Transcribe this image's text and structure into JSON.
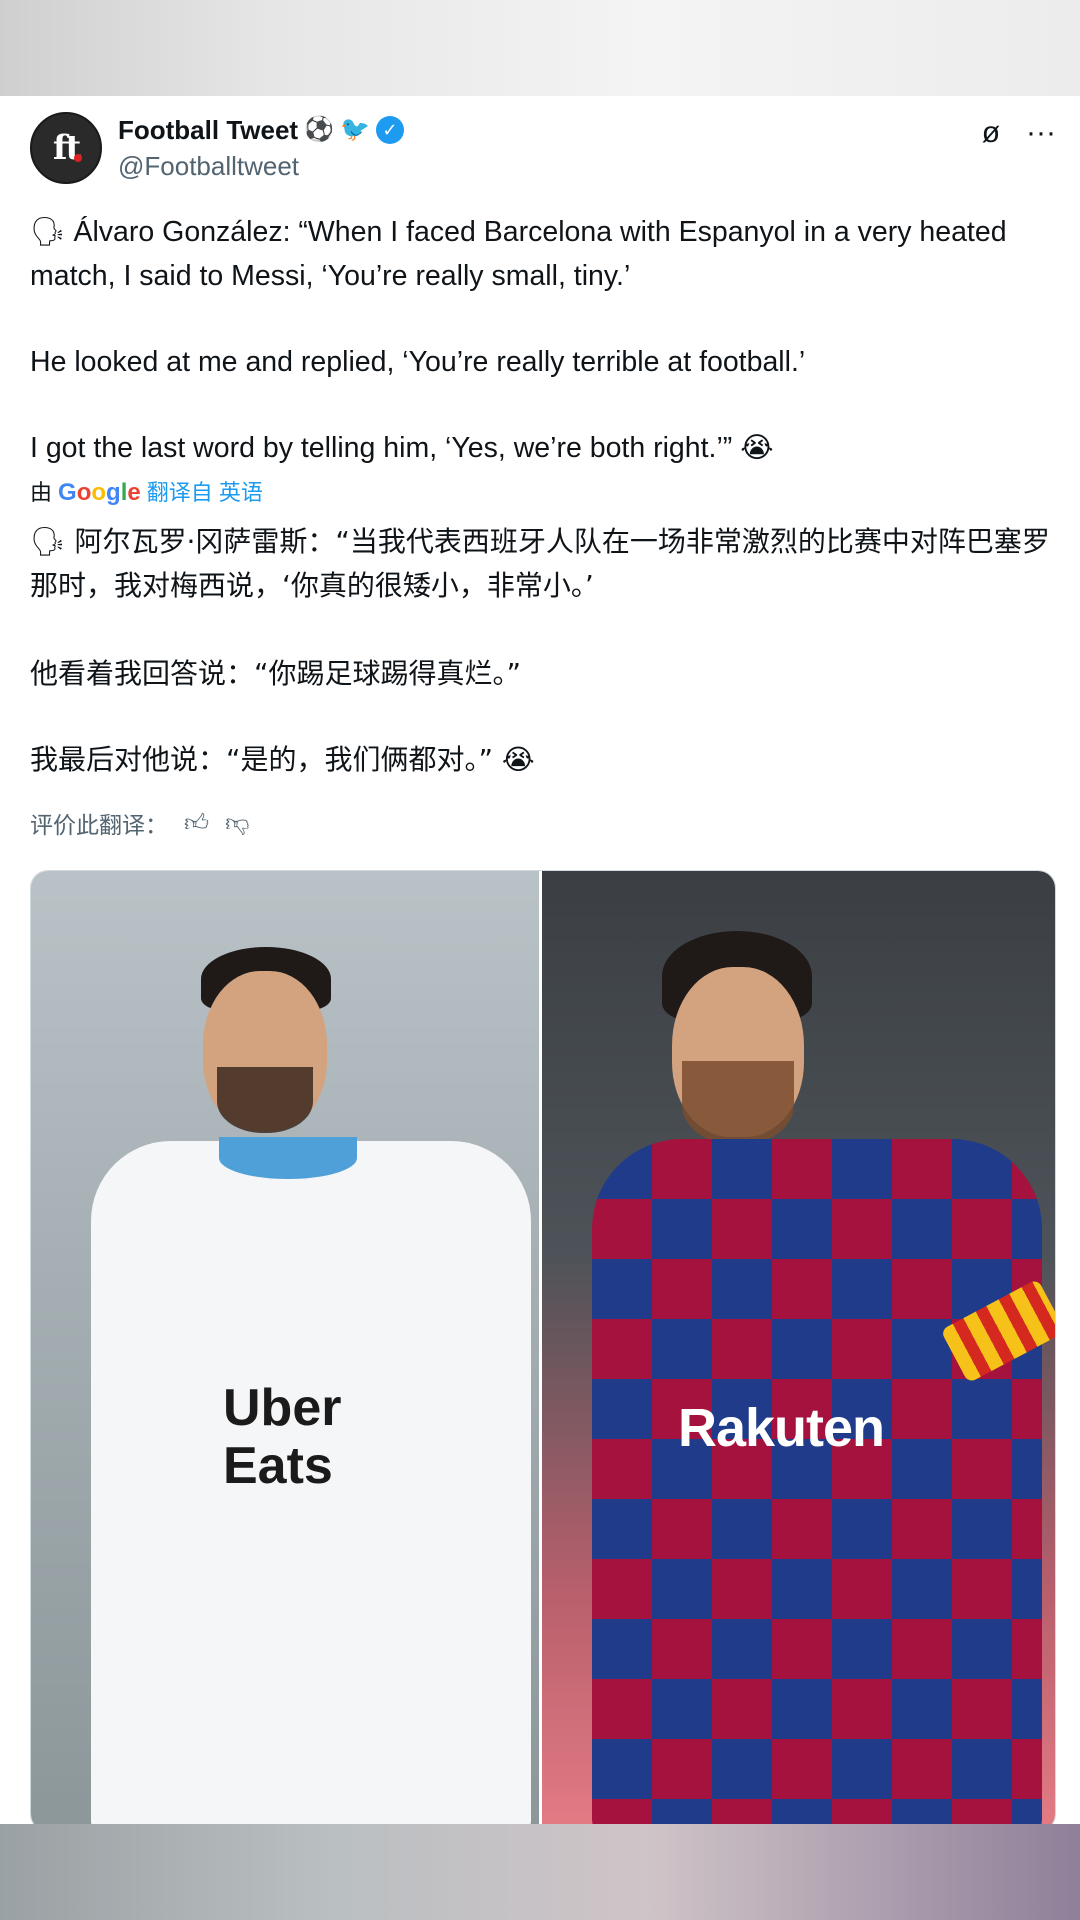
{
  "tweet": {
    "author_name": "Football Tweet",
    "author_emojis": [
      "⚽",
      "🐦"
    ],
    "handle": "@Footballtweet",
    "avatar_text": "ft",
    "original_lines": [
      "Álvaro González: “When I faced Barcelona with Espanyol in a very heated match, I said to Messi, ‘You’re really small, tiny.’",
      "He looked at me and replied, ‘You’re really terrible at football.’",
      "I got the last word by telling him, ‘Yes, we’re both right.’” 😭"
    ],
    "translation_prefix": "由",
    "translation_suffix": "翻译自 英语",
    "translated_lines": [
      "阿尔瓦罗·冈萨雷斯：“当我代表西班牙人队在一场非常激烈的比赛中对阵巴塞罗那时，我对梅西说，‘你真的很矮小，非常小。’",
      "他看着我回答说：“你踢足球踢得真烂。”",
      "我最后对他说：“是的，我们俩都对。” 😭"
    ],
    "rate_label": "评价此翻译：",
    "google_word": "Google"
  },
  "media": {
    "left_sponsor_line1": "Uber",
    "left_sponsor_line2": "Eats",
    "right_sponsor": "Rakuten"
  },
  "colors": {
    "accent": "#1d9bf0",
    "text": "#0f1419",
    "muted": "#536471"
  },
  "icons": [
    "verified-badge-icon",
    "grok-icon",
    "more-icon",
    "speaking-head-icon",
    "thumbs-up-icon",
    "thumbs-down-icon"
  ]
}
